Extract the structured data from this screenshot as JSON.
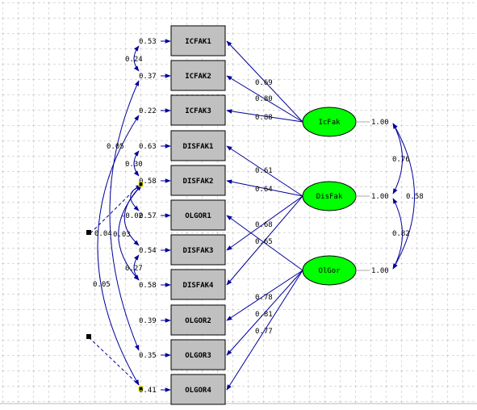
{
  "colors": {
    "path": "#00009c",
    "box": "#c0c0c0",
    "latent": "#00ff00",
    "grid": "#b8b8b8"
  },
  "observed": [
    {
      "name": "ICFAK1",
      "error": "0.53",
      "loading": "0.69",
      "factor": 0
    },
    {
      "name": "ICFAK2",
      "error": "0.37",
      "loading": "0.80",
      "factor": 0
    },
    {
      "name": "ICFAK3",
      "error": "0.22",
      "loading": "0.88",
      "factor": 0
    },
    {
      "name": "DISFAK1",
      "error": "0.63",
      "loading": "0.61",
      "factor": 1
    },
    {
      "name": "DISFAK2",
      "error": "0.58",
      "loading": "0.64",
      "factor": 1
    },
    {
      "name": "OLGOR1",
      "error": "0.57",
      "loading": "0.65",
      "factor": 2
    },
    {
      "name": "DISFAK3",
      "error": "0.54",
      "loading": "0.68",
      "factor": 1
    },
    {
      "name": "DISFAK4",
      "error": "0.58",
      "loading": "",
      "factor": 1
    },
    {
      "name": "OLGOR2",
      "error": "0.39",
      "loading": "0.78",
      "factor": 2
    },
    {
      "name": "OLGOR3",
      "error": "0.35",
      "loading": "0.81",
      "factor": 2
    },
    {
      "name": "OLGOR4",
      "error": "0.41",
      "loading": "0.77",
      "factor": 2
    }
  ],
  "latent": [
    {
      "name": "IcFak",
      "variance": "1.00"
    },
    {
      "name": "DisFak",
      "variance": "1.00"
    },
    {
      "name": "OlGor",
      "variance": "1.00"
    }
  ],
  "factor_correlations": [
    {
      "between": [
        "IcFak",
        "DisFak"
      ],
      "value": "0.76"
    },
    {
      "between": [
        "DisFak",
        "OlGor"
      ],
      "value": "0.82"
    },
    {
      "between": [
        "IcFak",
        "OlGor"
      ],
      "value": "0.58"
    }
  ],
  "error_covariances": [
    {
      "between": [
        "ICFAK1",
        "ICFAK2"
      ],
      "value": "0.24"
    },
    {
      "between": [
        "DISFAK1",
        "DISFAK2"
      ],
      "value": "0.30"
    },
    {
      "between": [
        "DISFAK3",
        "DISFAK4"
      ],
      "value": "0.27"
    },
    {
      "between": [
        "ICFAK2",
        "OLGOR3"
      ],
      "value": "0.05"
    },
    {
      "between": [
        "ICFAK3",
        "OLGOR4"
      ],
      "value": "0.05"
    },
    {
      "between": [
        "DISFAK2",
        "OLGOR1"
      ],
      "value": "-0.02"
    },
    {
      "between": [
        "DISFAK2",
        "DISFAK3"
      ],
      "value": "0.03"
    },
    {
      "between": [
        "DISFAK2",
        "DISFAK4"
      ],
      "value": "0.04"
    }
  ]
}
